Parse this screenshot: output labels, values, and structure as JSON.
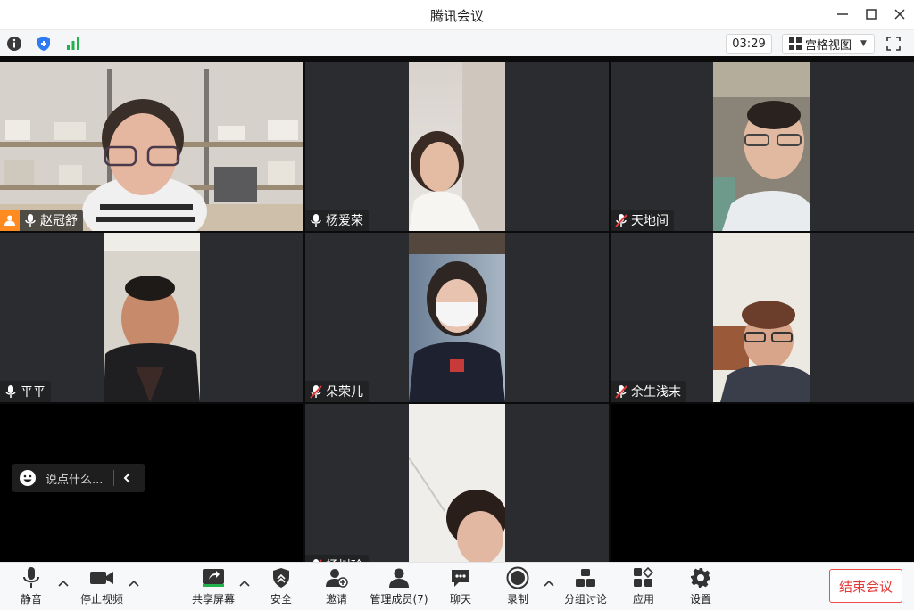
{
  "window": {
    "title": "腾讯会议"
  },
  "infobar": {
    "timer": "03:29",
    "view_label": "宫格视图"
  },
  "participants": [
    {
      "name": "赵冠舒",
      "mic": "on",
      "host": true,
      "active": true
    },
    {
      "name": "杨爱荣",
      "mic": "on"
    },
    {
      "name": "天地间",
      "mic": "muted"
    },
    {
      "name": "平平",
      "mic": "on"
    },
    {
      "name": "朵荣儿",
      "mic": "muted"
    },
    {
      "name": "余生浅末",
      "mic": "muted"
    },
    {
      "name": "杨树玲",
      "mic": "muted",
      "partially_visible": true
    }
  ],
  "chat": {
    "placeholder": "说点什么..."
  },
  "toolbar": {
    "mute": "静音",
    "stop_video": "停止视频",
    "share_screen": "共享屏幕",
    "security": "安全",
    "invite": "邀请",
    "manage_members": "管理成员(7)",
    "chat": "聊天",
    "record": "录制",
    "breakout": "分组讨论",
    "apps": "应用",
    "settings": "设置",
    "end_meeting": "结束会议"
  },
  "colors": {
    "accent": "#2fb35a",
    "danger": "#e43a3a",
    "host": "#ff8a1f",
    "info_blue": "#2f7bf6",
    "signal_green": "#22b14c"
  }
}
